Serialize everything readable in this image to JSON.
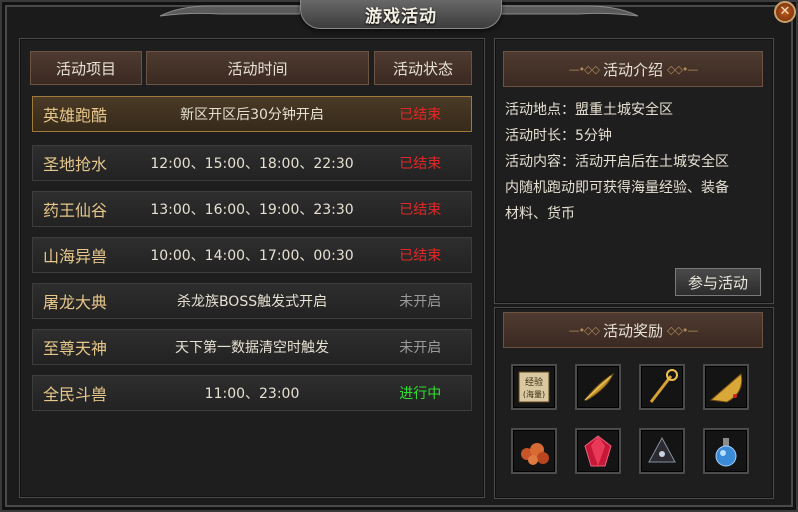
{
  "window": {
    "title": "游戏活动",
    "close_label": "✕"
  },
  "table": {
    "headers": [
      "活动项目",
      "活动时间",
      "活动状态"
    ],
    "rows": [
      {
        "name": "英雄跑酷",
        "time": "新区开区后30分钟开启",
        "status": "已结束",
        "status_color": "#e02828",
        "selected": true
      },
      {
        "name": "圣地抢水",
        "time": "12:00、15:00、18:00、22:30",
        "status": "已结束",
        "status_color": "#e02828"
      },
      {
        "name": "药王仙谷",
        "time": "13:00、16:00、19:00、23:30",
        "status": "已结束",
        "status_color": "#e02828"
      },
      {
        "name": "山海异兽",
        "time": "10:00、14:00、17:00、00:30",
        "status": "已结束",
        "status_color": "#e02828"
      },
      {
        "name": "屠龙大典",
        "time": "杀龙族BOSS触发式开启",
        "status": "未开启",
        "status_color": "#9a9a9a"
      },
      {
        "name": "至尊天神",
        "time": "天下第一数据清空时触发",
        "status": "未开启",
        "status_color": "#9a9a9a"
      },
      {
        "name": "全民斗兽",
        "time": "11:00、23:00",
        "status": "进行中",
        "status_color": "#2ee02e"
      }
    ]
  },
  "intro": {
    "title": "活动介绍",
    "lines": [
      "活动地点：盟重土城安全区",
      "活动时长：5分钟",
      "活动内容：活动开启后在土城安全区",
      "内随机跑动即可获得海量经验、装备",
      "材料、货币"
    ],
    "join_label": "参与活动"
  },
  "rewards": {
    "title": "活动奖励",
    "items": [
      {
        "icon": "exp-scroll-icon",
        "label": "经验\n(海量)"
      },
      {
        "icon": "feather-icon"
      },
      {
        "icon": "golden-staff-icon"
      },
      {
        "icon": "golden-fan-icon"
      },
      {
        "icon": "ore-pile-icon"
      },
      {
        "icon": "red-gem-icon"
      },
      {
        "icon": "dark-crystal-icon"
      },
      {
        "icon": "blue-potion-icon"
      }
    ],
    "exp_line1": "经验",
    "exp_line2": "(海量)"
  }
}
